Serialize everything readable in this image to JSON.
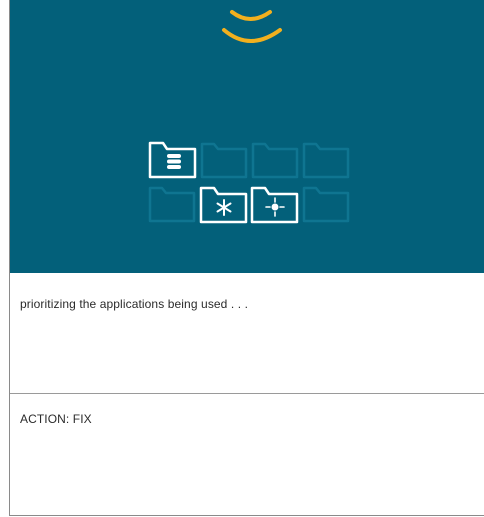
{
  "hero": {
    "background_color": "#03607a",
    "accent_color": "#f2b01e",
    "icons": [
      "database-folder-icon",
      "asterisk-folder-icon",
      "network-folder-icon"
    ]
  },
  "slide": {
    "caption": "prioritizing the applications being used . . .",
    "action_text": "ACTION: FIX"
  }
}
